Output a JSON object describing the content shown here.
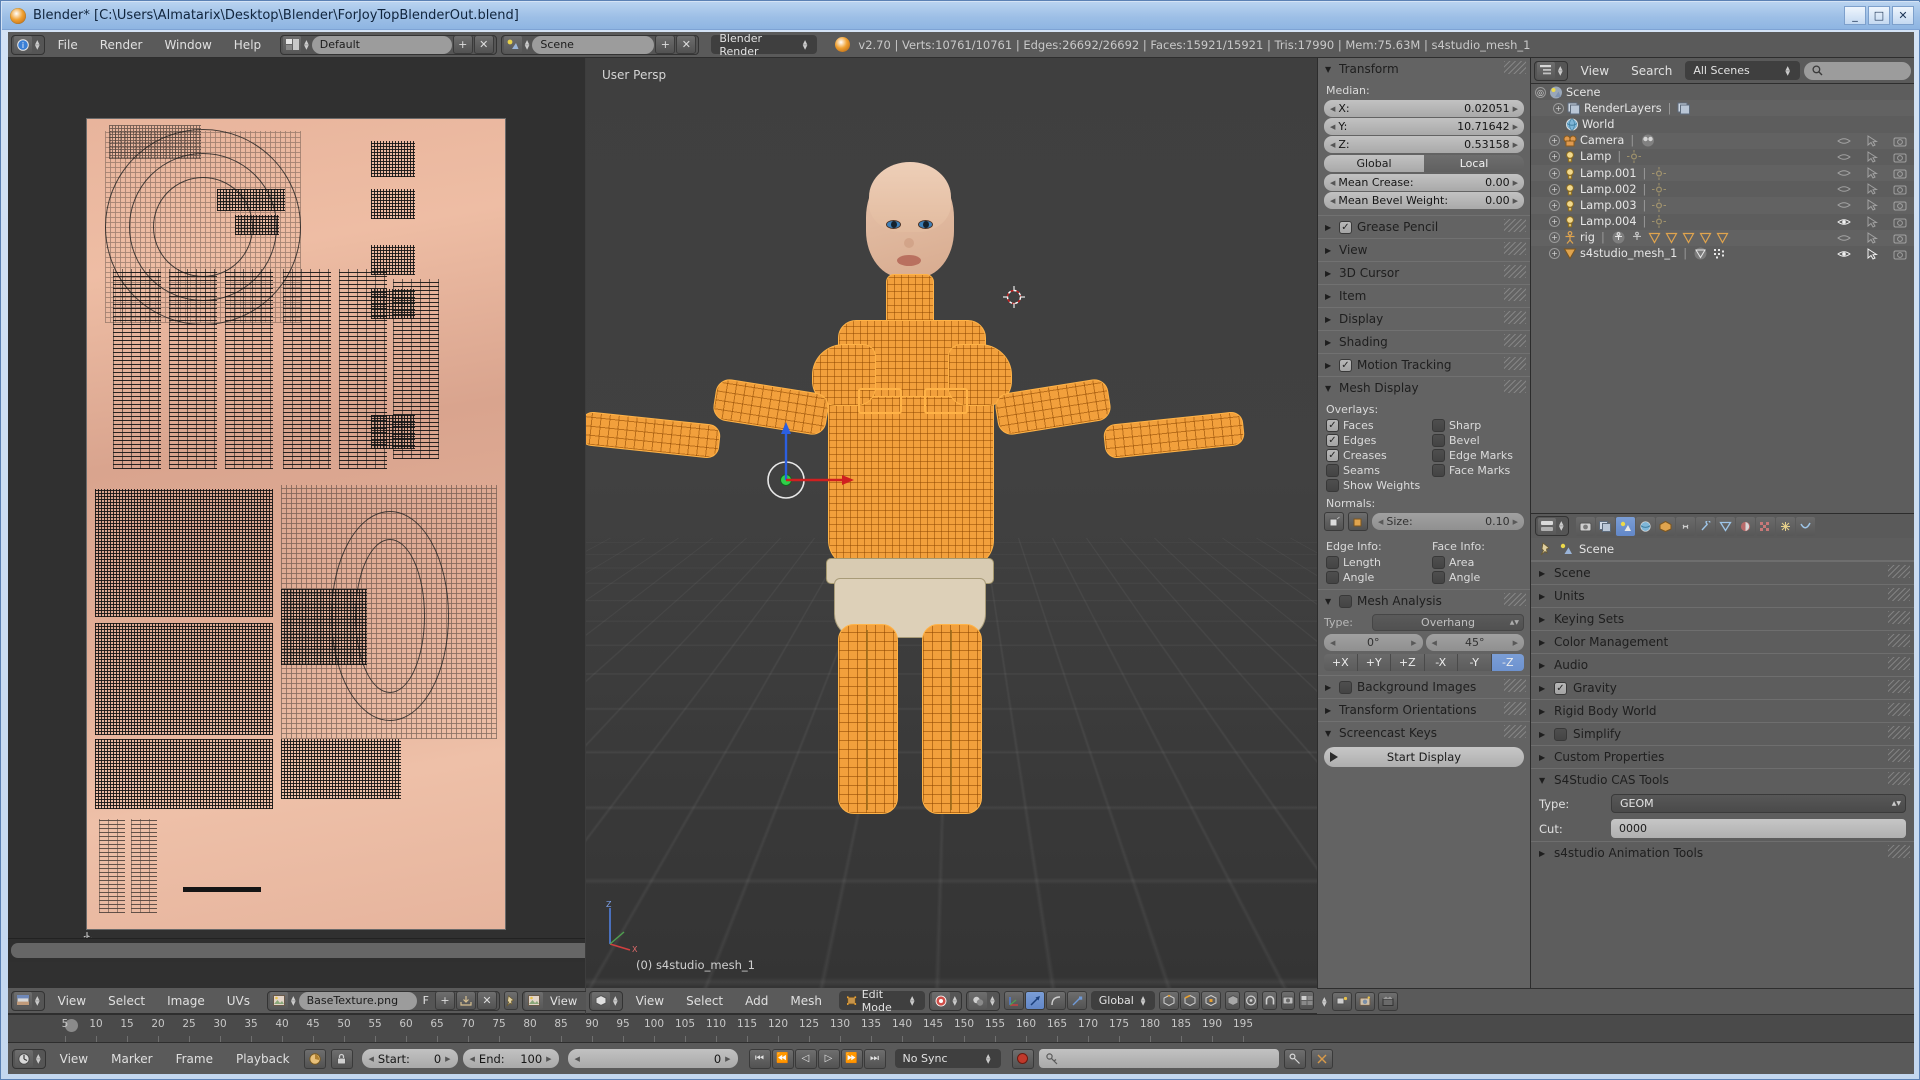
{
  "window": {
    "title": "Blender* [C:\\Users\\Almatarix\\Desktop\\Blender\\ForJoyTopBlenderOut.blend]",
    "minimize": "_",
    "maximize": "□",
    "close": "✕"
  },
  "top_header": {
    "menus": [
      "File",
      "Render",
      "Window",
      "Help"
    ],
    "screen_layout": "Default",
    "scene_name": "Scene",
    "render_engine": "Blender Render",
    "status": "v2.70 | Verts:10761/10761 | Edges:26692/26692 | Faces:15921/15921 | Tris:17990 | Mem:75.63M | s4studio_mesh_1",
    "add_label": "+",
    "remove_label": "✕"
  },
  "uv_editor": {
    "menus": [
      "View",
      "Select",
      "Image",
      "UVs"
    ],
    "image_name": "BaseTexture.png",
    "fake_user": "F",
    "add": "+",
    "unlink": "✕",
    "view_mode": "View",
    "pin": "⚓"
  },
  "view3d": {
    "menus": [
      "View",
      "Select",
      "Add",
      "Mesh"
    ],
    "mode": "Edit Mode",
    "transform_orientation": "Global",
    "persp_label": "User Persp",
    "object_label": "(0) s4studio_mesh_1"
  },
  "npanel": {
    "transform": {
      "title": "Transform",
      "median_label": "Median:",
      "fields": [
        {
          "label": "X:",
          "value": "0.02051"
        },
        {
          "label": "Y:",
          "value": "10.71642"
        },
        {
          "label": "Z:",
          "value": "0.53158"
        }
      ],
      "global_label": "Global",
      "local_label": "Local",
      "local_active": true,
      "mean_crease": {
        "label": "Mean Crease:",
        "value": "0.00"
      },
      "mean_bevel": {
        "label": "Mean Bevel Weight:",
        "value": "0.00"
      }
    },
    "collapsed_panels": [
      {
        "label": "Grease Pencil",
        "checkbox": true,
        "checked": true
      },
      {
        "label": "View",
        "checkbox": false
      },
      {
        "label": "3D Cursor",
        "checkbox": false
      },
      {
        "label": "Item",
        "checkbox": false
      },
      {
        "label": "Display",
        "checkbox": false
      },
      {
        "label": "Shading",
        "checkbox": false
      },
      {
        "label": "Motion Tracking",
        "checkbox": true,
        "checked": true
      }
    ],
    "mesh_display": {
      "title": "Mesh Display",
      "overlays_label": "Overlays:",
      "overlays": [
        {
          "label": "Faces",
          "checked": true
        },
        {
          "label": "Sharp",
          "checked": false
        },
        {
          "label": "Edges",
          "checked": true
        },
        {
          "label": "Bevel",
          "checked": false
        },
        {
          "label": "Creases",
          "checked": true
        },
        {
          "label": "Edge Marks",
          "checked": false
        },
        {
          "label": "Seams",
          "checked": false
        },
        {
          "label": "Face Marks",
          "checked": false
        }
      ],
      "show_weights": {
        "label": "Show Weights",
        "checked": false
      },
      "normals_label": "Normals:",
      "normals_size": {
        "label": "Size:",
        "value": "0.10"
      },
      "edge_info_label": "Edge Info:",
      "face_info_label": "Face Info:",
      "edge_info": [
        {
          "label": "Length",
          "checked": false
        },
        {
          "label": "Angle",
          "checked": false
        }
      ],
      "face_info": [
        {
          "label": "Area",
          "checked": false
        },
        {
          "label": "Angle",
          "checked": false
        }
      ]
    },
    "mesh_analysis": {
      "title": "Mesh Analysis",
      "enabled": false,
      "type_label": "Type:",
      "type_value": "Overhang",
      "min_angle": "0°",
      "max_angle": "45°",
      "axis_buttons": [
        "+X",
        "+Y",
        "+Z",
        "-X",
        "-Y",
        "-Z"
      ],
      "axis_active": "-Z"
    },
    "tail_panels": [
      {
        "label": "Background Images",
        "checkbox": true,
        "checked": false
      },
      {
        "label": "Transform Orientations",
        "checkbox": false
      }
    ],
    "screencast": {
      "title": "Screencast Keys",
      "button": "Start Display"
    }
  },
  "outliner": {
    "menus": [
      "View",
      "Search"
    ],
    "scope": "All Scenes",
    "search_placeholder": "",
    "rows": [
      {
        "name": "Scene",
        "depth": 0,
        "icon": "scene-icon",
        "expand": true,
        "restrict": [
          false,
          false,
          false
        ]
      },
      {
        "name": "RenderLayers",
        "depth": 1,
        "icon": "renderlayers-icon",
        "expand": true,
        "restrict": [
          false,
          false,
          false
        ]
      },
      {
        "name": "World",
        "depth": 1,
        "icon": "world-icon",
        "expand": false,
        "restrict": [
          false,
          false,
          false
        ]
      },
      {
        "name": "Camera",
        "depth": 1,
        "icon": "camera-icon",
        "expand": true,
        "restrict": [
          false,
          true,
          true
        ]
      },
      {
        "name": "Lamp",
        "depth": 1,
        "icon": "lamp-icon",
        "expand": true,
        "restrict": [
          false,
          true,
          true
        ]
      },
      {
        "name": "Lamp.001",
        "depth": 1,
        "icon": "lamp-icon",
        "expand": true,
        "restrict": [
          false,
          true,
          true
        ]
      },
      {
        "name": "Lamp.002",
        "depth": 1,
        "icon": "lamp-icon",
        "expand": true,
        "restrict": [
          false,
          true,
          true
        ]
      },
      {
        "name": "Lamp.003",
        "depth": 1,
        "icon": "lamp-icon",
        "expand": true,
        "restrict": [
          false,
          true,
          true
        ]
      },
      {
        "name": "Lamp.004",
        "depth": 1,
        "icon": "lamp-icon",
        "expand": true,
        "restrict": [
          true,
          true,
          true
        ]
      },
      {
        "name": "rig",
        "depth": 1,
        "icon": "armature-icon",
        "expand": true,
        "restrict": [
          false,
          true,
          true
        ]
      },
      {
        "name": "s4studio_mesh_1",
        "depth": 1,
        "icon": "mesh-icon",
        "expand": true,
        "restrict": [
          true,
          true,
          true
        ]
      }
    ]
  },
  "properties": {
    "breadcrumb": "Scene",
    "panels": [
      {
        "label": "Scene",
        "checkbox": false
      },
      {
        "label": "Units",
        "checkbox": false
      },
      {
        "label": "Keying Sets",
        "checkbox": false
      },
      {
        "label": "Color Management",
        "checkbox": false
      },
      {
        "label": "Audio",
        "checkbox": false
      },
      {
        "label": "Gravity",
        "checkbox": true,
        "checked": true
      },
      {
        "label": "Rigid Body World",
        "checkbox": false
      },
      {
        "label": "Simplify",
        "checkbox": true,
        "checked": false
      },
      {
        "label": "Custom Properties",
        "checkbox": false
      }
    ],
    "cas_tools": {
      "title": "S4Studio CAS Tools",
      "type_label": "Type:",
      "type_value": "GEOM",
      "cut_label": "Cut:",
      "cut_value": "0000"
    },
    "anim_tools": {
      "label": "s4studio Animation Tools"
    }
  },
  "timeline": {
    "menus": [
      "View",
      "Marker",
      "Frame",
      "Playback"
    ],
    "start": {
      "label": "Start:",
      "value": "0"
    },
    "end": {
      "label": "End:",
      "value": "100"
    },
    "current": {
      "value": "0"
    },
    "sync_mode": "No Sync",
    "ticks": [
      5,
      10,
      15,
      20,
      25,
      30,
      35,
      40,
      45,
      50,
      55,
      60,
      65,
      70,
      75,
      80,
      85,
      90,
      95,
      100,
      105,
      110,
      115,
      120,
      125,
      130,
      135,
      140,
      145,
      150,
      155,
      160,
      165,
      170,
      175,
      180,
      185,
      190,
      195
    ],
    "transport": [
      "⏮",
      "⏪",
      "◁",
      "▷",
      "⏩",
      "⏭"
    ]
  },
  "colors": {
    "accent_blue": "#6d92cf",
    "mesh_orange": "#f2a03c",
    "panel_gray": "#636363",
    "header_gray": "#5a5a5a",
    "viewport_bg": "#3f3f3f",
    "record_red": "#c0392b"
  }
}
